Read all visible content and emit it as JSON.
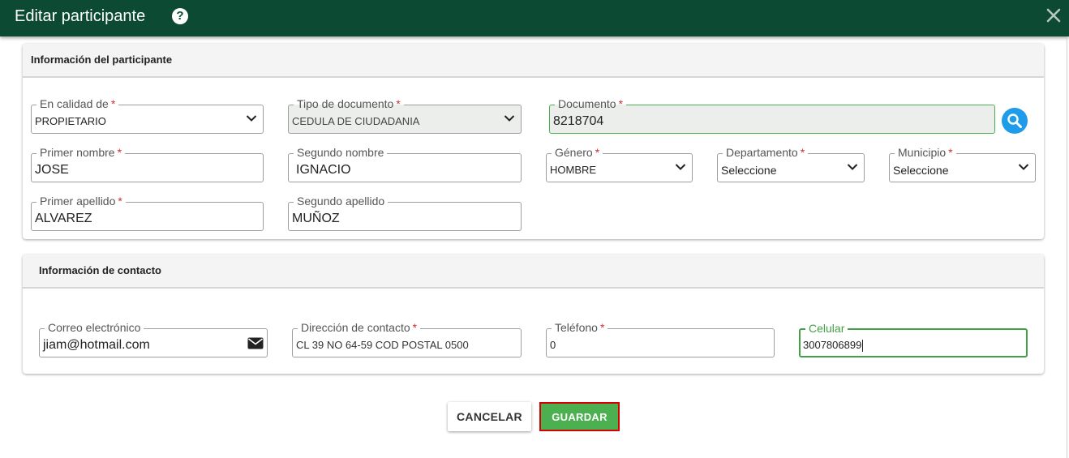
{
  "dialog": {
    "title": "Editar participante",
    "help_icon": "question-circle-icon",
    "close_icon": "close-icon",
    "header_color": "#0c4a33"
  },
  "participant_section": {
    "title": "Información del participante",
    "calidad": {
      "label": "En calidad de",
      "required": "*",
      "value": "PROPIETARIO"
    },
    "tipo_documento": {
      "label": "Tipo de documento",
      "required": "*",
      "value": "CEDULA DE CIUDADANIA"
    },
    "documento": {
      "label": "Documento",
      "required": "*",
      "value": "8218704"
    },
    "search_icon": "search-icon",
    "primer_nombre": {
      "label": "Primer nombre",
      "required": "*",
      "value": "JOSE"
    },
    "segundo_nombre": {
      "label": "Segundo nombre",
      "value": "IGNACIO"
    },
    "genero": {
      "label": "Género",
      "required": "*",
      "value": "HOMBRE"
    },
    "departamento": {
      "label": "Departamento",
      "required": "*",
      "value": "Seleccione"
    },
    "municipio": {
      "label": "Municipio",
      "required": "*",
      "value": "Seleccione"
    },
    "primer_apellido": {
      "label": "Primer apellido",
      "required": "*",
      "value": "ALVAREZ"
    },
    "segundo_apellido": {
      "label": "Segundo apellido",
      "value": "MUÑOZ"
    }
  },
  "contact_section": {
    "title": "Información de contacto",
    "correo": {
      "label": "Correo electrónico",
      "value": "jiam@hotmail.com",
      "icon": "envelope-icon"
    },
    "direccion": {
      "label": "Dirección de contacto",
      "required": "*",
      "value": "CL 39 NO 64-59 COD POSTAL 0500"
    },
    "telefono": {
      "label": "Teléfono",
      "required": "*",
      "value": "0"
    },
    "celular": {
      "label": "Celular",
      "value": "3007806899"
    }
  },
  "actions": {
    "cancel_label": "CANCELAR",
    "save_label": "GUARDAR",
    "save_color": "#4caf50",
    "highlight_color": "#d50000"
  }
}
